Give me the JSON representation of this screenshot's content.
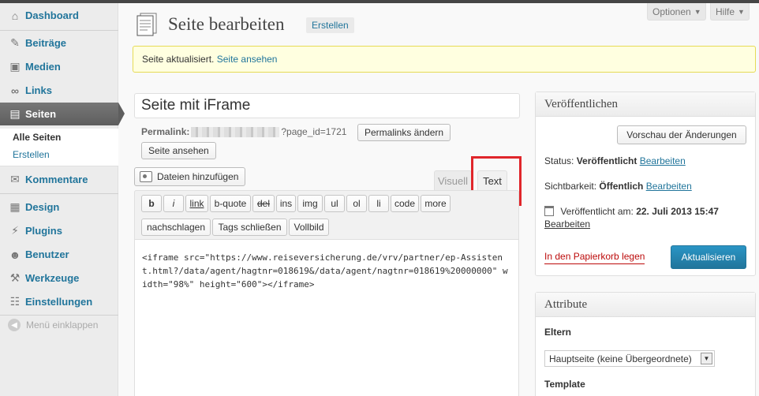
{
  "sidebar": {
    "items": [
      {
        "label": "Dashboard",
        "icon": "dashboard-icon"
      },
      {
        "label": "Beiträge",
        "icon": "pushpin-icon"
      },
      {
        "label": "Medien",
        "icon": "media-icon"
      },
      {
        "label": "Links",
        "icon": "link-icon"
      },
      {
        "label": "Seiten",
        "icon": "pages-icon"
      },
      {
        "label": "Kommentare",
        "icon": "comment-icon"
      },
      {
        "label": "Design",
        "icon": "design-icon"
      },
      {
        "label": "Plugins",
        "icon": "plugin-icon"
      },
      {
        "label": "Benutzer",
        "icon": "users-icon"
      },
      {
        "label": "Werkzeuge",
        "icon": "tools-icon"
      },
      {
        "label": "Einstellungen",
        "icon": "settings-icon"
      }
    ],
    "submenu": [
      "Alle Seiten",
      "Erstellen"
    ],
    "collapse_label": "Menü einklappen"
  },
  "header": {
    "screen_options": "Optionen",
    "help": "Hilfe",
    "title": "Seite bearbeiten",
    "add_new": "Erstellen"
  },
  "notice": {
    "text": "Seite aktualisiert.",
    "link": "Seite ansehen"
  },
  "editor": {
    "post_title": "Seite mit iFrame",
    "permalink_label": "Permalink:",
    "permalink_suffix": "?page_id=1721",
    "change_permalinks": "Permalinks ändern",
    "view_page": "Seite ansehen",
    "add_media": "Dateien hinzufügen",
    "tab_visual": "Visuell",
    "tab_text": "Text",
    "quicktags_row1": [
      "b",
      "i",
      "link",
      "b-quote",
      "del",
      "ins",
      "img",
      "ul",
      "ol",
      "li",
      "code",
      "more"
    ],
    "quicktags_row2": [
      "nachschlagen",
      "Tags schließen",
      "Vollbild"
    ],
    "content": "<iframe src=\"https://www.reiseversicherung.de/vrv/partner/ep-Assistent.html?/data/agent/hagtnr=018619&/data/agent/nagtnr=018619%20000000\" width=\"98%\" height=\"600\"></iframe>"
  },
  "publish": {
    "title": "Veröffentlichen",
    "preview": "Vorschau der Änderungen",
    "status_label": "Status:",
    "status_value": "Veröffentlicht",
    "visibility_label": "Sichtbarkeit:",
    "visibility_value": "Öffentlich",
    "edit": "Bearbeiten",
    "published_label": "Veröffentlicht am:",
    "published_value": "22. Juli 2013 15:47",
    "trash": "In den Papierkorb legen",
    "update": "Aktualisieren"
  },
  "attributes": {
    "title": "Attribute",
    "parent_label": "Eltern",
    "parent_value": "Hauptseite (keine Übergeordnete)",
    "template_label": "Template"
  },
  "colors": {
    "link": "#21759b",
    "highlight_box": "#e0262b",
    "notice_bg": "#ffffe0",
    "trash": "#bc0b0b"
  }
}
